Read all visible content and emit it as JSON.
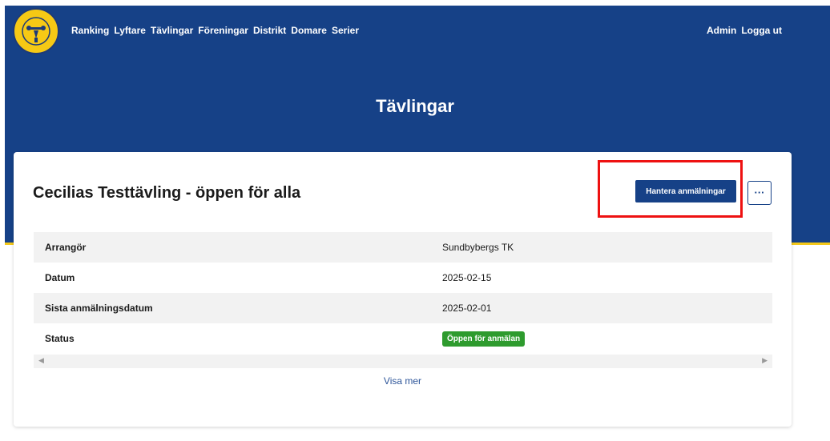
{
  "nav": {
    "items": [
      "Ranking",
      "Lyftare",
      "Tävlingar",
      "Föreningar",
      "Distrikt",
      "Domare",
      "Serier"
    ],
    "right": [
      "Admin",
      "Logga ut"
    ]
  },
  "hero": {
    "title": "Tävlingar"
  },
  "competition": {
    "title": "Cecilias Testtävling - öppen för alla",
    "manage_button": "Hantera anmälningar",
    "more_button": "···",
    "rows": [
      {
        "label": "Arrangör",
        "value": "Sundbybergs TK"
      },
      {
        "label": "Datum",
        "value": "2025-02-15"
      },
      {
        "label": "Sista anmälningsdatum",
        "value": "2025-02-01"
      },
      {
        "label": "Status",
        "value": "Öppen för anmälan"
      }
    ],
    "show_more": "Visa mer"
  },
  "colors": {
    "brand_blue": "#164187",
    "accent_yellow": "#f4c81a",
    "status_green": "#2e9b2e",
    "highlight_red": "#ee1111"
  },
  "icons": {
    "logo": "federation-logo",
    "scroll_left": "arrow-left-icon",
    "scroll_right": "arrow-right-icon"
  }
}
